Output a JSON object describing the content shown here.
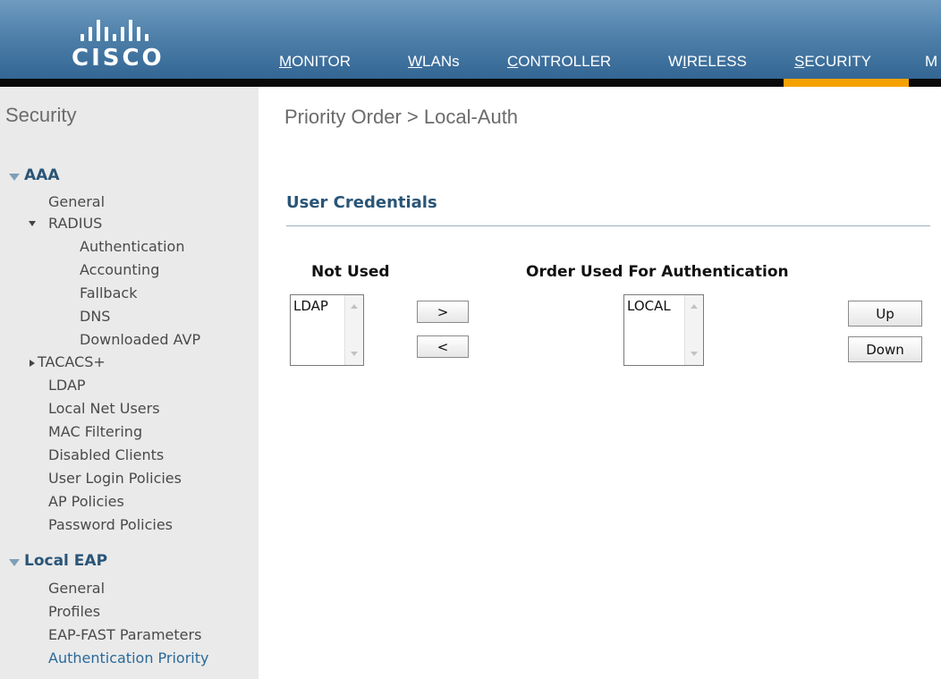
{
  "brand": {
    "name": "cisco",
    "logo_text": "CISCO"
  },
  "nav": [
    {
      "first": "M",
      "rest": "ONITOR"
    },
    {
      "first": "W",
      "rest": "LANs"
    },
    {
      "first": "C",
      "rest": "ONTROLLER"
    },
    {
      "pre": "W",
      "first": "I",
      "rest": "RELESS"
    },
    {
      "first": "S",
      "rest": "ECURITY"
    },
    {
      "first": "M",
      "rest": ""
    }
  ],
  "sidebar": {
    "title": "Security",
    "aaa": {
      "label": "AAA",
      "items": {
        "general": "General",
        "radius": "RADIUS",
        "tacacs": "TACACS+",
        "ldap": "LDAP",
        "local_net_users": "Local Net Users",
        "mac_filtering": "MAC Filtering",
        "disabled_clients": "Disabled Clients",
        "user_login_policies": "User Login Policies",
        "ap_policies": "AP Policies",
        "password_policies": "Password Policies"
      },
      "radius_items": {
        "authentication": "Authentication",
        "accounting": "Accounting",
        "fallback": "Fallback",
        "dns": "DNS",
        "downloaded_avp": "Downloaded AVP"
      }
    },
    "local_eap": {
      "label": "Local EAP",
      "items": {
        "general": "General",
        "profiles": "Profiles",
        "eap_fast": "EAP-FAST Parameters",
        "auth_priority": "Authentication Priority"
      }
    }
  },
  "main": {
    "title": "Priority Order > Local-Auth",
    "section": "User Credentials",
    "not_used_label": "Not Used",
    "order_label": "Order Used For Authentication",
    "not_used_options": [
      "LDAP"
    ],
    "order_options": [
      "LOCAL"
    ],
    "buttons": {
      "add": ">",
      "remove": "<",
      "up": "Up",
      "down": "Down"
    }
  }
}
